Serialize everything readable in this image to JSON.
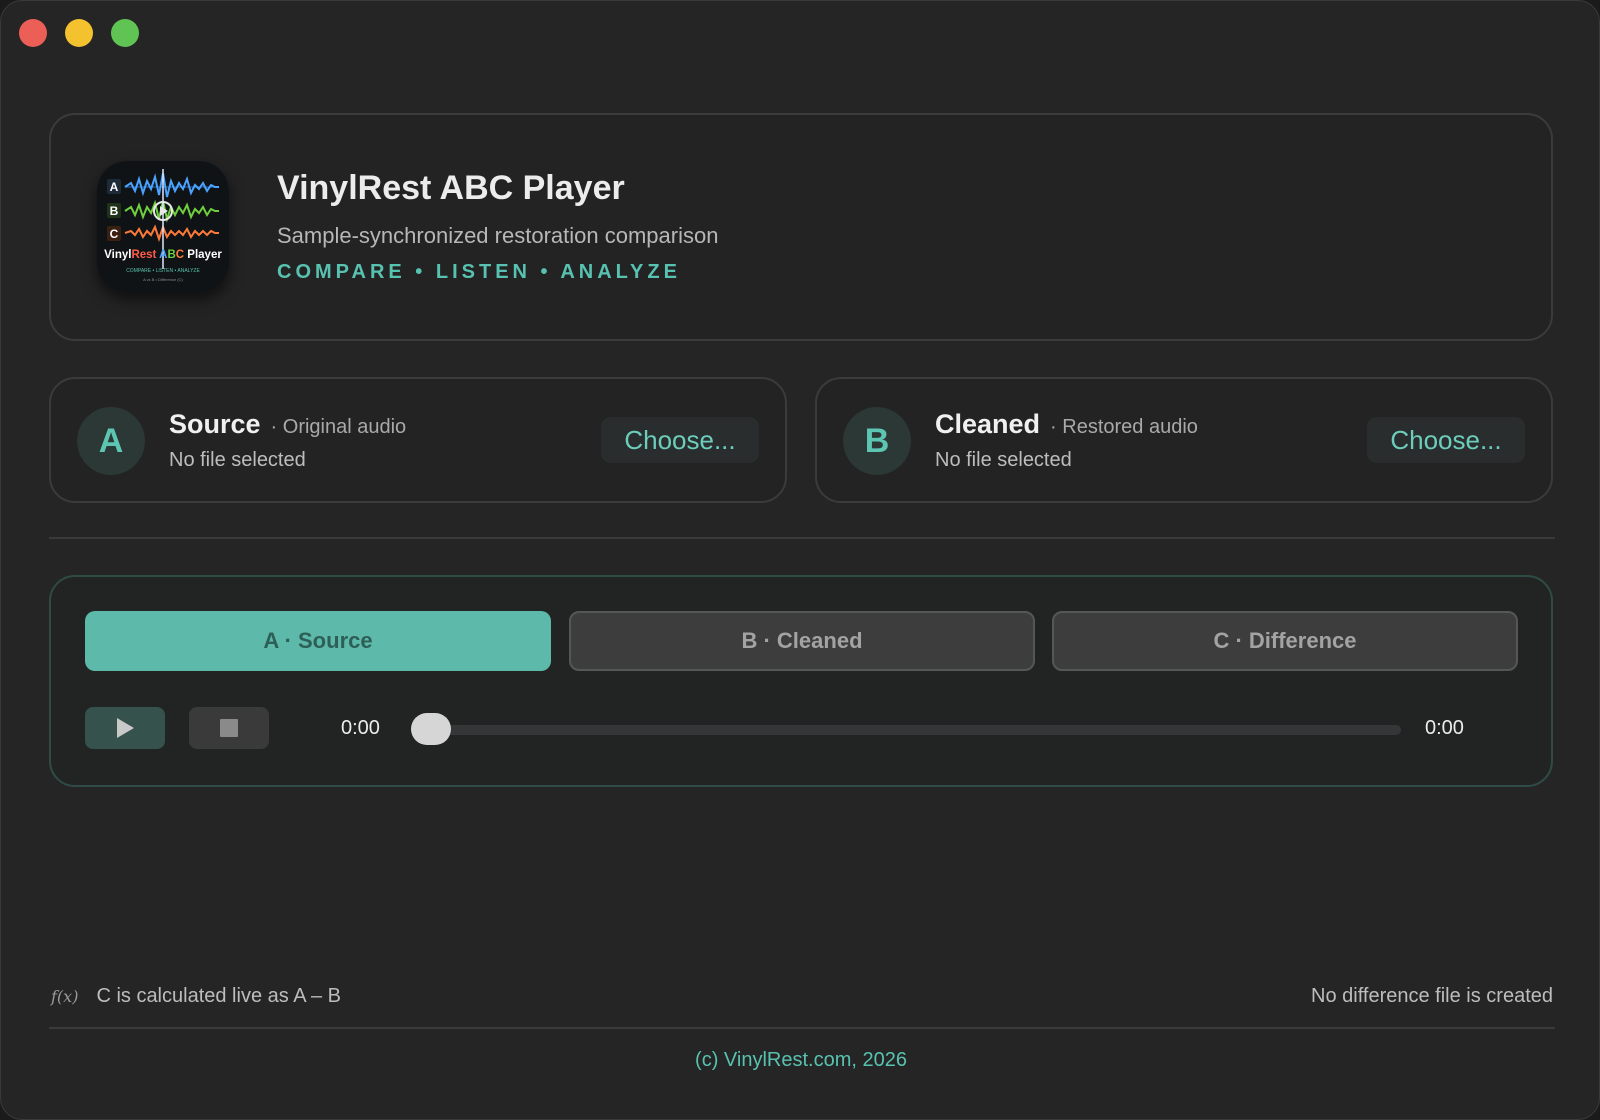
{
  "window": {
    "controls": [
      "close",
      "minimize",
      "zoom"
    ]
  },
  "header": {
    "title": "VinylRest ABC Player",
    "subtitle": "Sample-synchronized restoration comparison",
    "tagline": "COMPARE • LISTEN • ANALYZE",
    "icon": {
      "tracks": [
        "A",
        "B",
        "C"
      ],
      "name_parts": [
        "Vinyl",
        "Rest",
        " A",
        "B",
        "C",
        " Player"
      ],
      "tagline": "COMPARE • LISTEN • ANALYZE",
      "formula": "A vs B • Difference (C)"
    }
  },
  "sources": {
    "a": {
      "badge": "A",
      "name": "Source",
      "desc": "· Original audio",
      "status": "No file selected",
      "button": "Choose..."
    },
    "b": {
      "badge": "B",
      "name": "Cleaned",
      "desc": "· Restored audio",
      "status": "No file selected",
      "button": "Choose..."
    }
  },
  "player": {
    "tabs": [
      {
        "label": "A · Source",
        "selected": true
      },
      {
        "label": "B · Cleaned",
        "selected": false
      },
      {
        "label": "C · Difference",
        "selected": false
      }
    ],
    "current_time": "0:00",
    "total_time": "0:00",
    "progress": 0
  },
  "footer": {
    "fx_icon": "f(x)",
    "note": "C is calculated live as A – B",
    "right_note": "No difference file is created",
    "copyright": "(c) VinylRest.com, 2026"
  },
  "colors": {
    "accent": "#58c2b0",
    "selected_tab": "#5dbaab",
    "background": "#252526"
  }
}
